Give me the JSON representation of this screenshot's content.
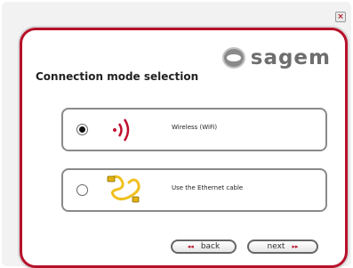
{
  "window": {
    "close_label": "×"
  },
  "logo": {
    "text": "sagem"
  },
  "page": {
    "title": "Connection mode selection"
  },
  "options": [
    {
      "label": "Wireless (WiFi)",
      "selected": true,
      "icon": "wifi-icon"
    },
    {
      "label": "Use the Ethernet cable",
      "selected": false,
      "icon": "ethernet-cable-icon"
    }
  ],
  "nav": {
    "back_label": "back",
    "next_label": "next",
    "back_arrow": "◂◂",
    "next_arrow": "▸▸"
  },
  "colors": {
    "accent": "#b8102a",
    "cable": "#f0c020"
  }
}
